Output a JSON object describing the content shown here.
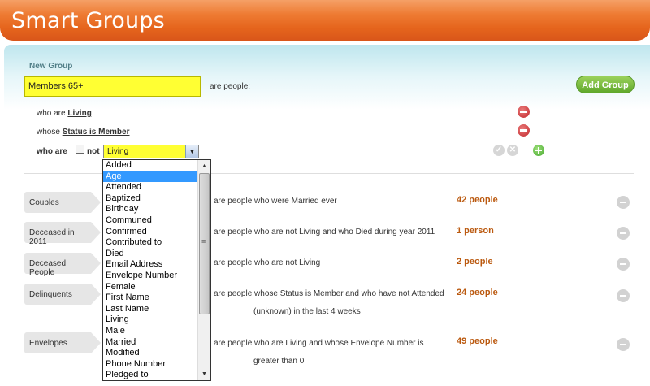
{
  "header": {
    "title": "Smart Groups"
  },
  "new_group": {
    "label": "New Group",
    "name_value": "Members 65+",
    "are_people": "are people:",
    "add_button": "Add Group",
    "conditions": [
      {
        "prefix": "who are",
        "value": "Living"
      },
      {
        "prefix": "whose",
        "value": "Status is Member"
      }
    ],
    "new_condition": {
      "who_are": "who are",
      "not_label": "not",
      "selected": "Living",
      "options": [
        "Added",
        "Age",
        "Attended",
        "Baptized",
        "Birthday",
        "Communed",
        "Confirmed",
        "Contributed to",
        "Died",
        "Email Address",
        "Envelope Number",
        "Female",
        "First Name",
        "Last Name",
        "Living",
        "Male",
        "Married",
        "Modified",
        "Phone Number",
        "Pledged to"
      ],
      "highlighted_option": "Age"
    }
  },
  "groups": [
    {
      "name": "Couples",
      "description": "are people who were Married ever",
      "count": "42 people"
    },
    {
      "name": "Deceased in 2011",
      "description": "are people who are not Living and who Died during year 2011",
      "count": "1 person"
    },
    {
      "name": "Deceased People",
      "description": "are people who are not Living",
      "count": "2 people"
    },
    {
      "name": "Delinquents",
      "description": "are people whose Status is Member and who have not Attended",
      "description_line2": "(unknown) in the last 4 weeks",
      "count": "24 people"
    },
    {
      "name": "Envelopes",
      "description": "are people who are Living and whose Envelope Number is",
      "description_line2": "greater than 0",
      "count": "49 people"
    }
  ],
  "colors": {
    "header": "#e5641c",
    "input_highlight": "#ffff33",
    "add_button": "#6fb534",
    "count": "#bb5a10",
    "remove_red": "#c2282c"
  }
}
